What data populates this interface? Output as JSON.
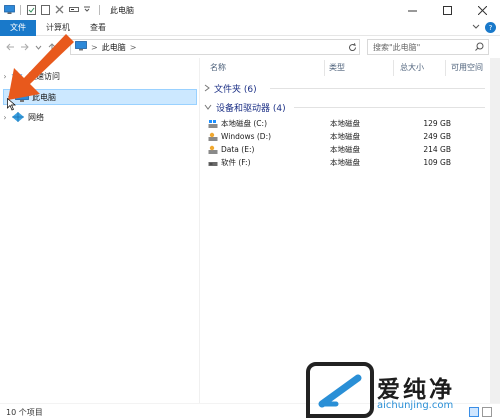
{
  "window": {
    "title": "此电脑"
  },
  "ribbon": {
    "tabs": [
      "文件",
      "计算机",
      "查看"
    ]
  },
  "address": {
    "path": "此电脑",
    "separator": ">"
  },
  "search": {
    "placeholder": "搜索\"此电脑\""
  },
  "nav": {
    "items": [
      {
        "label": "快速访问",
        "icon": "star-icon"
      },
      {
        "label": "此电脑",
        "icon": "monitor-icon",
        "selected": true
      },
      {
        "label": "网络",
        "icon": "network-icon"
      }
    ]
  },
  "columns": [
    "名称",
    "类型",
    "总大小",
    "可用空间"
  ],
  "groups": [
    {
      "label": "文件夹 (6)",
      "expanded": false
    },
    {
      "label": "设备和驱动器 (4)",
      "expanded": true
    }
  ],
  "drives": [
    {
      "name": "本地磁盘 (C:)",
      "type": "本地磁盘",
      "size": "129 GB",
      "icon": "windows-drive-icon"
    },
    {
      "name": "Windows (D:)",
      "type": "本地磁盘",
      "size": "249 GB",
      "icon": "drive-icon"
    },
    {
      "name": "Data (E:)",
      "type": "本地磁盘",
      "size": "214 GB",
      "icon": "drive-icon"
    },
    {
      "name": "软件 (F:)",
      "type": "本地磁盘",
      "size": "109 GB",
      "icon": "drive-icon"
    }
  ],
  "status": {
    "count": "10 个项目"
  },
  "watermark": {
    "brand": "爱纯净",
    "url": "aichunjing.com"
  },
  "colors": {
    "accent": "#1979ca",
    "selection": "#cce8ff",
    "arrow": "#e8591c",
    "group": "#1e3287"
  }
}
